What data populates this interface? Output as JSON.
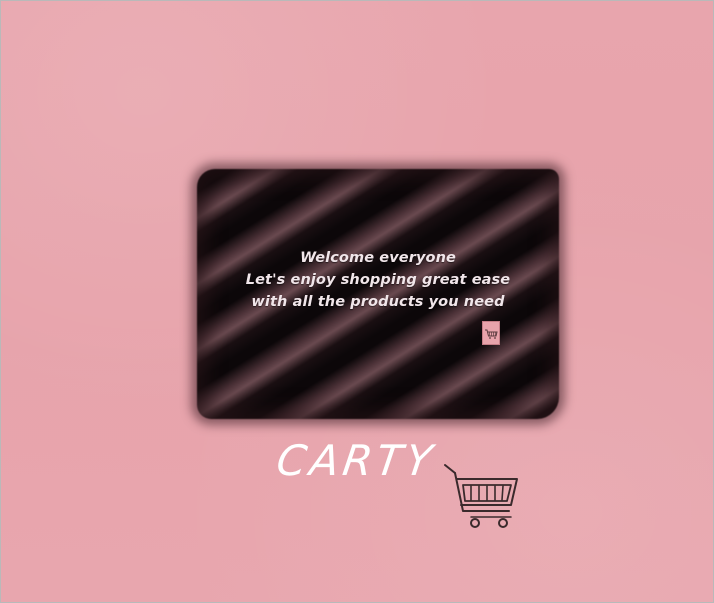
{
  "splash": {
    "line1": "Welcome everyone",
    "line2": "Let's  enjoy shopping  great ease",
    "line3": "with all the products you need"
  },
  "brand": {
    "name": "CARTY"
  },
  "colors": {
    "background": "#e8a6ad",
    "panel_dark": "#0b0709",
    "panel_light": "#6a4a50",
    "text_light": "#f1e6ea",
    "brand_text": "#ffffff",
    "icon_stroke": "#3a2a2c"
  },
  "icons": {
    "small": "shopping-cart-icon",
    "large": "shopping-cart-icon"
  }
}
